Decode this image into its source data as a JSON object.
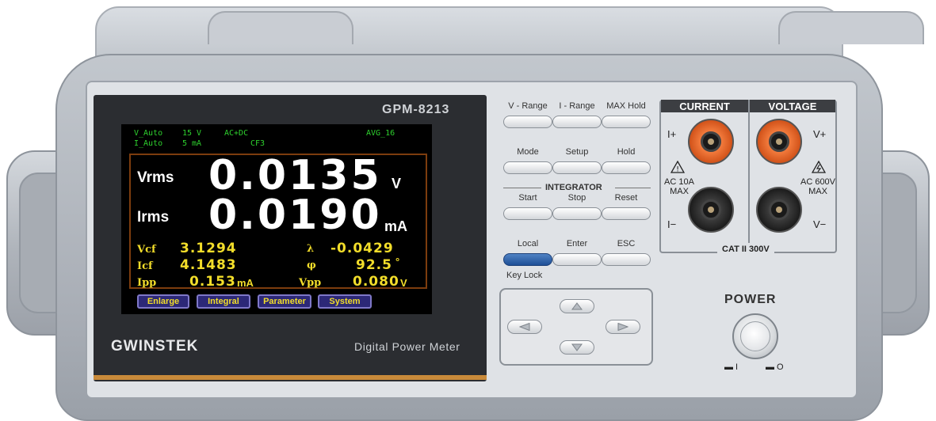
{
  "device": {
    "model": "GPM-8213",
    "brand": "GWINSTEK",
    "product_name": "Digital Power Meter"
  },
  "status": {
    "v_range": "V_Auto",
    "v_range_value": "15 V",
    "coupling": "AC+DC",
    "average": "AVG_16",
    "i_range": "I_Auto",
    "i_range_value": "5 mA",
    "crest_factor": "CF3"
  },
  "main_readings": [
    {
      "label": "Vrms",
      "value": "0.0135",
      "unit": "V"
    },
    {
      "label": "Irms",
      "value": "0.0190",
      "unit": "mA"
    }
  ],
  "sub_readings": {
    "vcf": {
      "label": "Vcf",
      "value": "3.1294",
      "unit": ""
    },
    "icf": {
      "label": "Icf",
      "value": "4.1483",
      "unit": ""
    },
    "ipp": {
      "label": "Ipp",
      "value": "0.153",
      "unit": "mA"
    },
    "lambda": {
      "label": "λ",
      "value": "-0.0429",
      "unit": ""
    },
    "phi": {
      "label": "φ",
      "value": "92.5",
      "unit": "°"
    },
    "vpp": {
      "label": "Vpp",
      "value": "0.080",
      "unit": "V"
    }
  },
  "softkeys": [
    "Enlarge",
    "Integral",
    "Parameter",
    "System"
  ],
  "keys": {
    "v_range": "V - Range",
    "i_range": "I - Range",
    "max_hold": "MAX Hold",
    "mode": "Mode",
    "setup": "Setup",
    "hold": "Hold",
    "integrator": "INTEGRATOR",
    "start": "Start",
    "stop": "Stop",
    "reset": "Reset",
    "local": "Local",
    "enter": "Enter",
    "esc": "ESC",
    "key_lock": "Key Lock"
  },
  "terminals": {
    "current_title": "CURRENT",
    "voltage_title": "VOLTAGE",
    "i_plus": "I+",
    "i_minus": "I−",
    "v_plus": "V+",
    "v_minus": "V−",
    "current_rating_1": "AC 10A",
    "current_rating_2": "MAX",
    "voltage_rating_1": "AC 600V",
    "voltage_rating_2": "MAX",
    "category": "CAT II 300V"
  },
  "power": {
    "label": "POWER",
    "on_symbol": "▬ I",
    "off_symbol": "▬ O"
  },
  "colors": {
    "lcd_background": "#000000",
    "status_text": "#2ed12e",
    "reading_primary": "#ffffff",
    "reading_secondary": "#f2dd2a",
    "softkey_background": "#2c2877",
    "current_jack": "#e0602a",
    "accent_strip": "#c98a3a"
  }
}
